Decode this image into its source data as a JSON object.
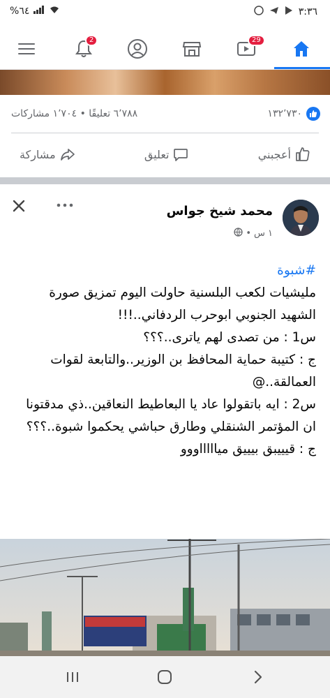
{
  "status_bar": {
    "time": "٣:٣٦",
    "battery": "%٦٤"
  },
  "top_nav": {
    "notifications_badge": "2",
    "video_badge": "29",
    "icons": [
      "menu-icon",
      "bell-icon",
      "profile-icon",
      "marketplace-icon",
      "video-icon",
      "home-icon"
    ]
  },
  "prev_post": {
    "likes_count": "١٣٢٬٧٣٠",
    "comments": "٦٬٧٨٨ تعليقًا",
    "shares": "١٬٧٠٤ مشاركات",
    "separator_dot": "•",
    "like_label": "أعجبني",
    "comment_label": "تعليق",
    "share_label": "مشاركة"
  },
  "post": {
    "author": "محمد شيخ جواس",
    "time": "١ س",
    "meta_dot": "•",
    "hashtag": "#شبوة",
    "lines": [
      "مليشيات لكعب البلسنية حاولت اليوم تمزيق صورة الشهيد الجنوبي ابوحرب الردفاني..!!!",
      "س1 : من تصدى لهم ياترى..؟؟؟",
      "ج : كتيبة حماية المحافظ بن الوزير..والتابعة لقوات العمالقة..@",
      "س2 : ايه باتقولوا عاد يا البعاطيط النعاقين..ذي مدقتونا ان المؤتمر الشنقلي وطارق حباشي يحكموا شبوة..؟؟؟",
      "ج : قيييبق بيييق مياااااووو"
    ]
  },
  "colors": {
    "accent": "#1877f2",
    "badge": "#e41e3f",
    "secondary_text": "#65676b"
  }
}
